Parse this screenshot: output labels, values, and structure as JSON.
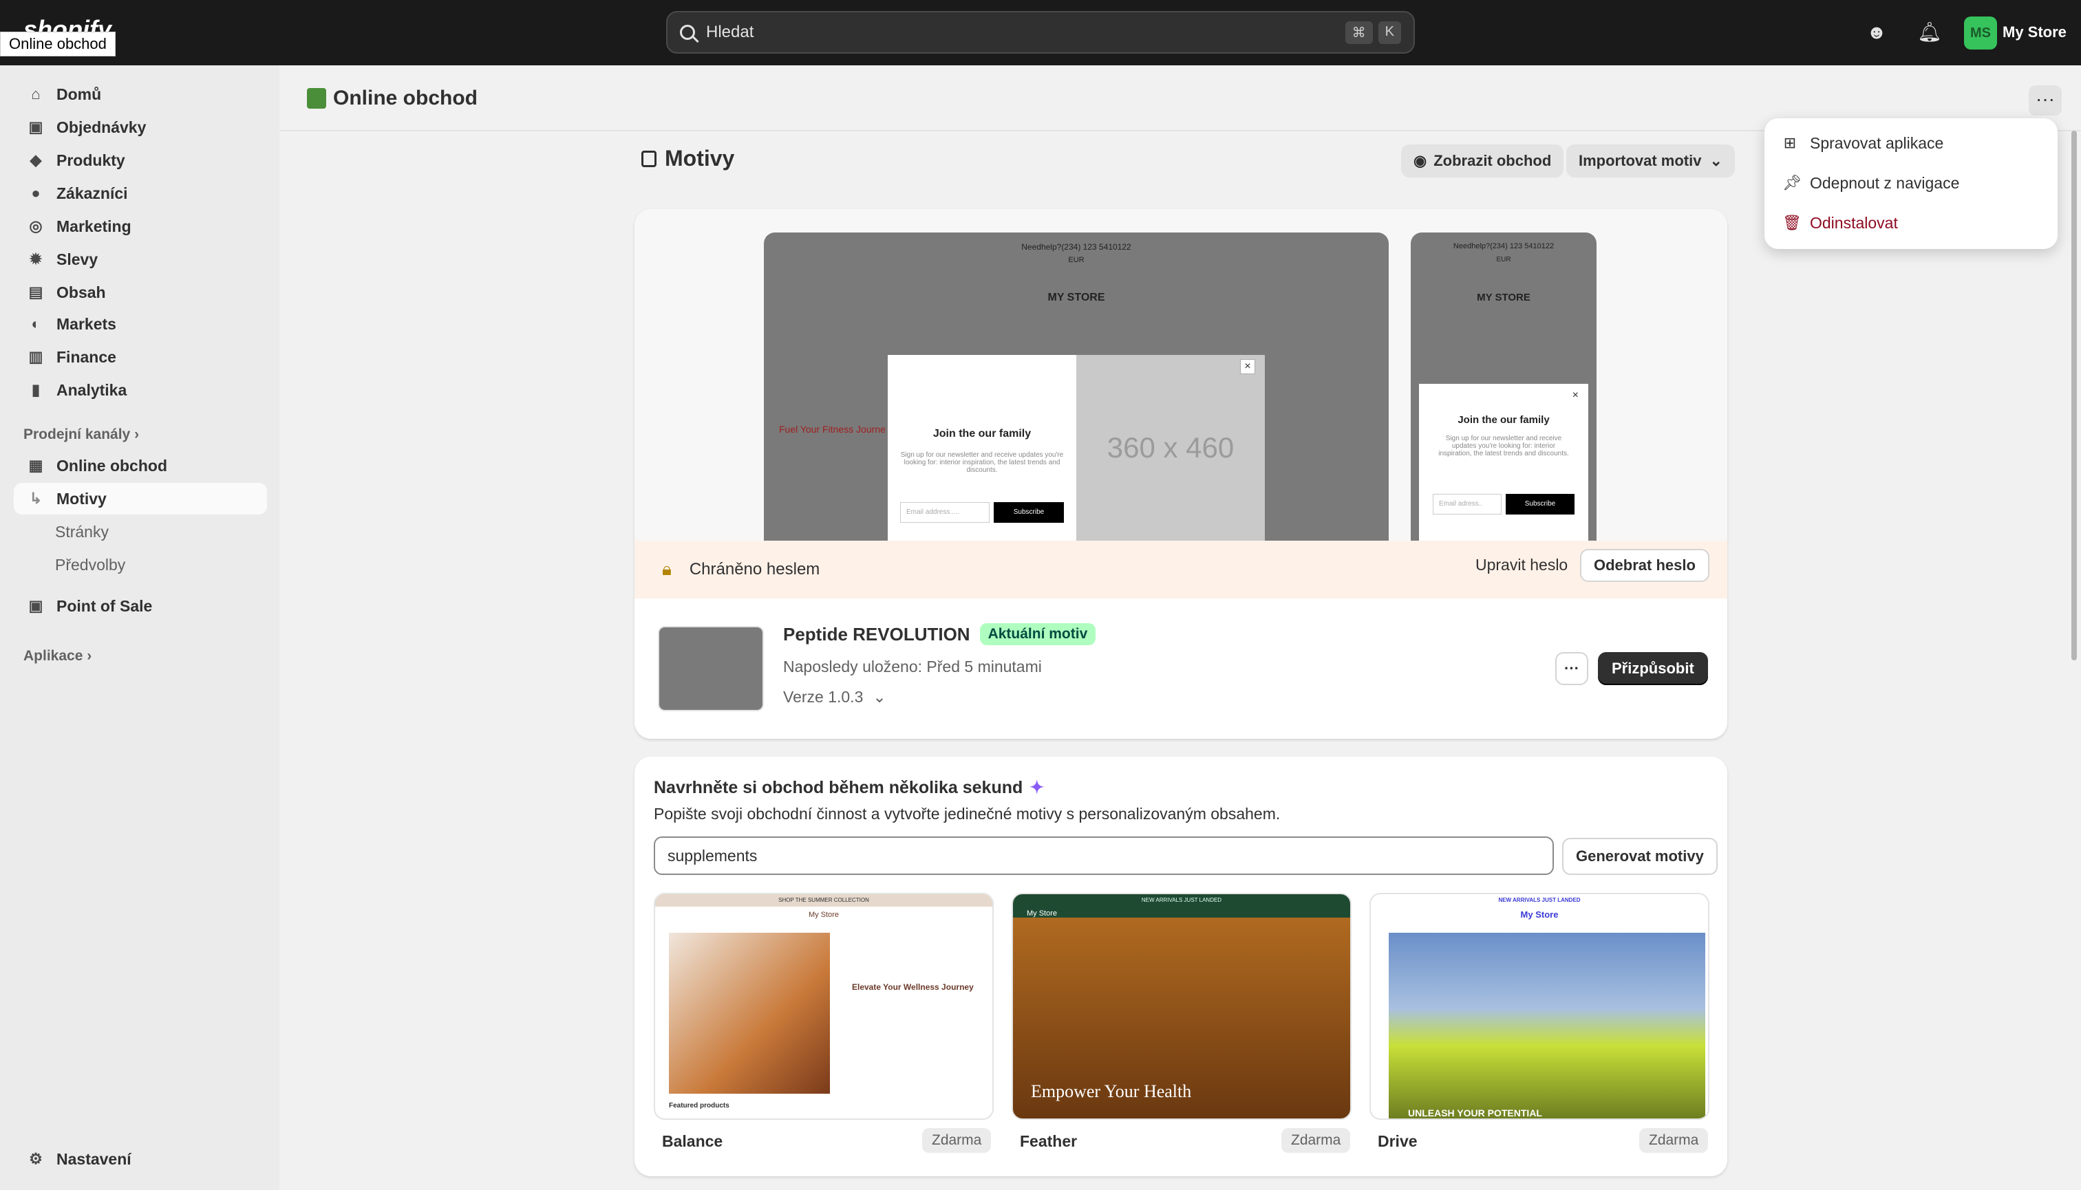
{
  "topbar": {
    "logo": "shopify",
    "logo_tooltip": "Online obchod",
    "search_placeholder": "Hledat",
    "search_key1": "⌘",
    "search_key2": "K",
    "avatar_initials": "MS",
    "store_name": "My Store"
  },
  "sidebar": {
    "items": [
      {
        "label": "Domů",
        "icon": "home-icon"
      },
      {
        "label": "Objednávky",
        "icon": "inbox-icon"
      },
      {
        "label": "Produkty",
        "icon": "tag-icon"
      },
      {
        "label": "Zákazníci",
        "icon": "person-icon"
      },
      {
        "label": "Marketing",
        "icon": "target-icon"
      },
      {
        "label": "Slevy",
        "icon": "discount-icon"
      },
      {
        "label": "Obsah",
        "icon": "content-icon"
      },
      {
        "label": "Markets",
        "icon": "globe-icon"
      },
      {
        "label": "Finance",
        "icon": "bank-icon"
      },
      {
        "label": "Analytika",
        "icon": "chart-icon"
      }
    ],
    "sales_channels": "Prodejní kanály",
    "online_store": "Online obchod",
    "sub_items": [
      "Motivy",
      "Stránky",
      "Předvolby"
    ],
    "pos": "Point of Sale",
    "apps": "Aplikace",
    "settings": "Nastavení"
  },
  "appbar": {
    "title": "Online obchod",
    "dots": "···"
  },
  "dropdown": {
    "items": [
      {
        "label": "Spravovat aplikace",
        "icon": "apps-icon"
      },
      {
        "label": "Odepnout z navigace",
        "icon": "pin-icon"
      },
      {
        "label": "Odinstalovat",
        "icon": "trash-icon"
      }
    ]
  },
  "page": {
    "title": "Motivy",
    "view_store": "Zobrazit obchod",
    "import_theme": "Importovat motiv"
  },
  "preview": {
    "topline": "Needhelp?(234) 123 5410122",
    "currency": "EUR",
    "store": "MY STORE",
    "hero_text": "Fuel Your Fitness Journe",
    "popup_title": "Join the our family",
    "popup_body": "Sign up for our newsletter and receive updates you're looking for: interior inspiration, the latest trends and discounts.",
    "popup_email": "Email address.....",
    "popup_btn": "Subscribe",
    "popup_size": "360 x 460",
    "mob_popup_body": "Sign up for our newsletter and receive updates you're looking for: interior inspiration, the latest trends and discounts.",
    "mob_email": "Email adress..",
    "close": "×"
  },
  "password": {
    "text": "Chráněno heslem",
    "edit": "Upravit heslo",
    "remove": "Odebrat heslo"
  },
  "current_theme": {
    "name": "Peptide REVOLUTION",
    "badge": "Aktuální motiv",
    "saved": "Naposledy uloženo: Před 5 minutami",
    "version": "Verze 1.0.3",
    "customize": "Přizpůsobit",
    "more": "···"
  },
  "generator": {
    "title": "Navrhněte si obchod během několika sekund",
    "subtitle": "Popište svoji obchodní činnost a vytvořte jedinečné motivy s personalizovaným obsahem.",
    "input_value": "supplements",
    "button": "Generovat motivy",
    "themes": [
      {
        "name": "Balance",
        "price": "Zdarma",
        "banner": "SHOP THE SUMMER COLLECTION",
        "store": "My Store",
        "headline": "Elevate Your Wellness Journey",
        "footer": "Featured products"
      },
      {
        "name": "Feather",
        "price": "Zdarma",
        "banner": "NEW ARRIVALS JUST LANDED",
        "store": "My Store",
        "headline": "Empower Your Health"
      },
      {
        "name": "Drive",
        "price": "Zdarma",
        "banner": "NEW ARRIVALS JUST LANDED",
        "store": "My Store",
        "headline": "UNLEASH YOUR POTENTIAL"
      }
    ]
  },
  "colors": {
    "topbar": "#1a1a1a",
    "accent_green": "#36c35c",
    "danger": "#8e0b21"
  }
}
